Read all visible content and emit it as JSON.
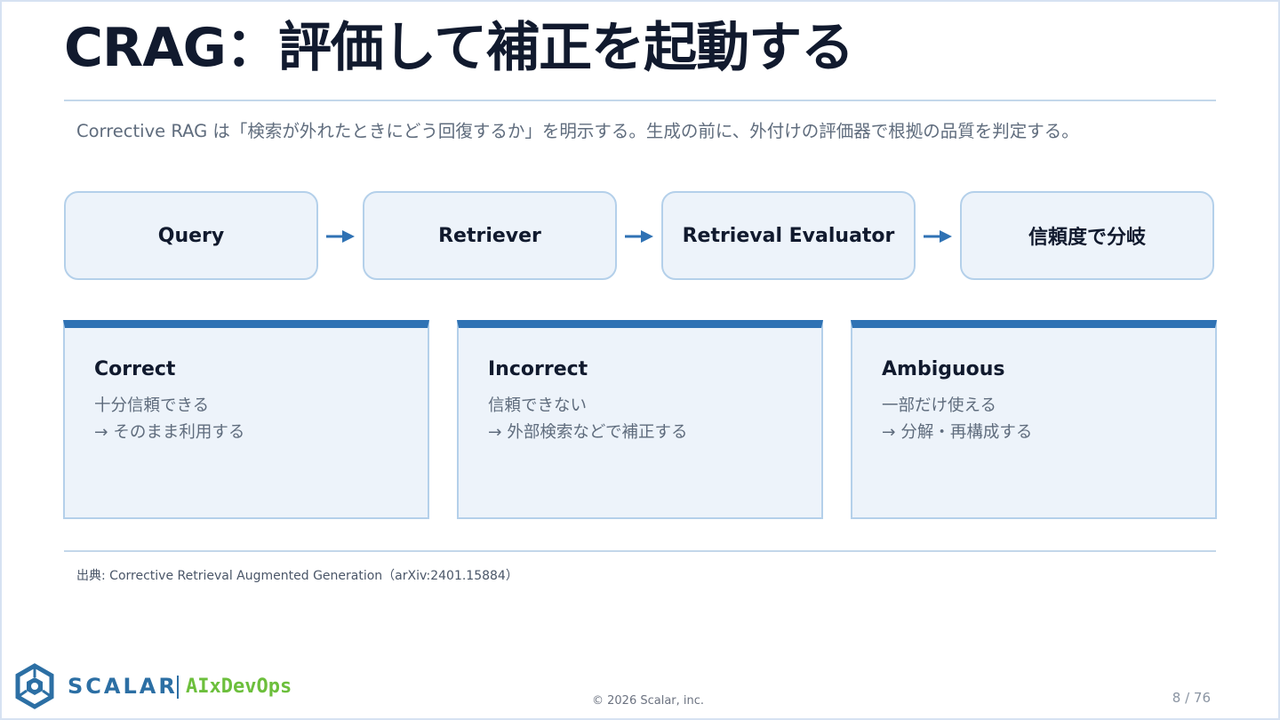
{
  "slide": {
    "title": "CRAG：評価して補正を起動する",
    "lead": "Corrective RAG は「検索が外れたときにどう回復するか」を明示する。生成の前に、外付けの評価器で根拠の品質を判定する。",
    "flow": [
      {
        "label": "Query"
      },
      {
        "label": "Retriever"
      },
      {
        "label": "Retrieval Evaluator"
      },
      {
        "label": "信頼度で分岐"
      }
    ],
    "cards": [
      {
        "title": "Correct",
        "line1": "十分信頼できる",
        "line2": "→ そのまま利用する"
      },
      {
        "title": "Incorrect",
        "line1": "信頼できない",
        "line2": "→ 外部検索などで補正する"
      },
      {
        "title": "Ambiguous",
        "line1": "一部だけ使える",
        "line2": "→ 分解・再構成する"
      }
    ],
    "source": "出典: Corrective Retrieval Augmented Generation（arXiv:2401.15884）"
  },
  "footer": {
    "brand": "SCALAR",
    "sub_brand": "AIxDevOps",
    "copyright": "© 2026 Scalar, inc.",
    "page": "8 / 76",
    "logo_icon": "scalar-logo-icon"
  },
  "colors": {
    "accent": "#2f72b4",
    "box_fill": "#edf3fa",
    "box_border": "#b4d0ea",
    "title_text": "#111a2e",
    "body_text": "#5f6c7d",
    "brand": "#2c6fa4",
    "sub_brand": "#6cbf3c"
  }
}
